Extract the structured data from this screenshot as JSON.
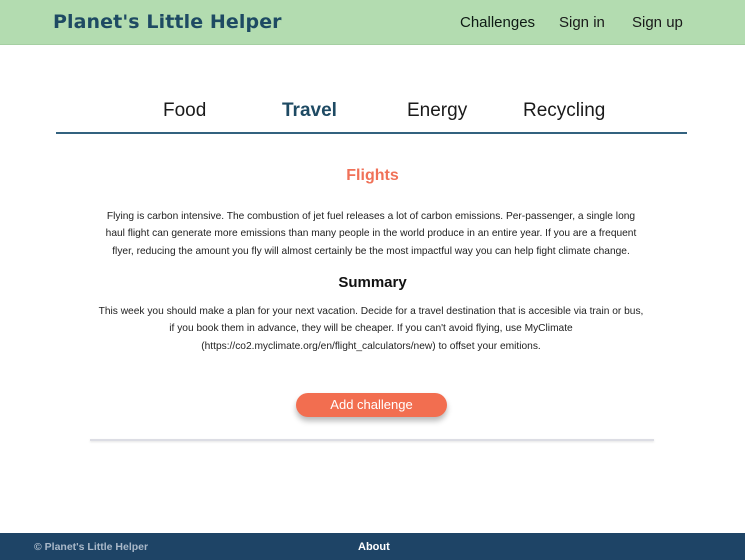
{
  "header": {
    "brand": "Planet's Little Helper",
    "nav": {
      "challenges": "Challenges",
      "sign_in": "Sign in",
      "sign_up": "Sign up"
    }
  },
  "tabs": [
    {
      "label": "Food"
    },
    {
      "label": "Travel",
      "active": true
    },
    {
      "label": "Energy"
    },
    {
      "label": "Recycling"
    }
  ],
  "content": {
    "heading": "Flights",
    "intro": "Flying is carbon intensive. The combustion of jet fuel releases a lot of carbon emissions. Per-passenger, a single long haul flight can generate more emissions than many people in the world produce in an entire year. If you are a frequent flyer, reducing the amount you fly will almost certainly be the most impactful way you can help fight climate change.",
    "summary_title": "Summary",
    "summary": "This week you should make a plan for your next vacation. Decide for a travel destination that is accesible via train or bus, if you book them in advance, they will be cheaper. If you can't avoid flying, use MyClimate (https://co2.myclimate.org/en/flight_calculators/new) to offset your emitions.",
    "cta": "Add challenge"
  },
  "footer": {
    "copyright": "© Planet's Little Helper",
    "about": "About"
  },
  "colors": {
    "header_bg": "#b3dcb0",
    "brand": "#1e4a63",
    "accent": "#f26e50",
    "footer_bg": "#1e4466"
  }
}
